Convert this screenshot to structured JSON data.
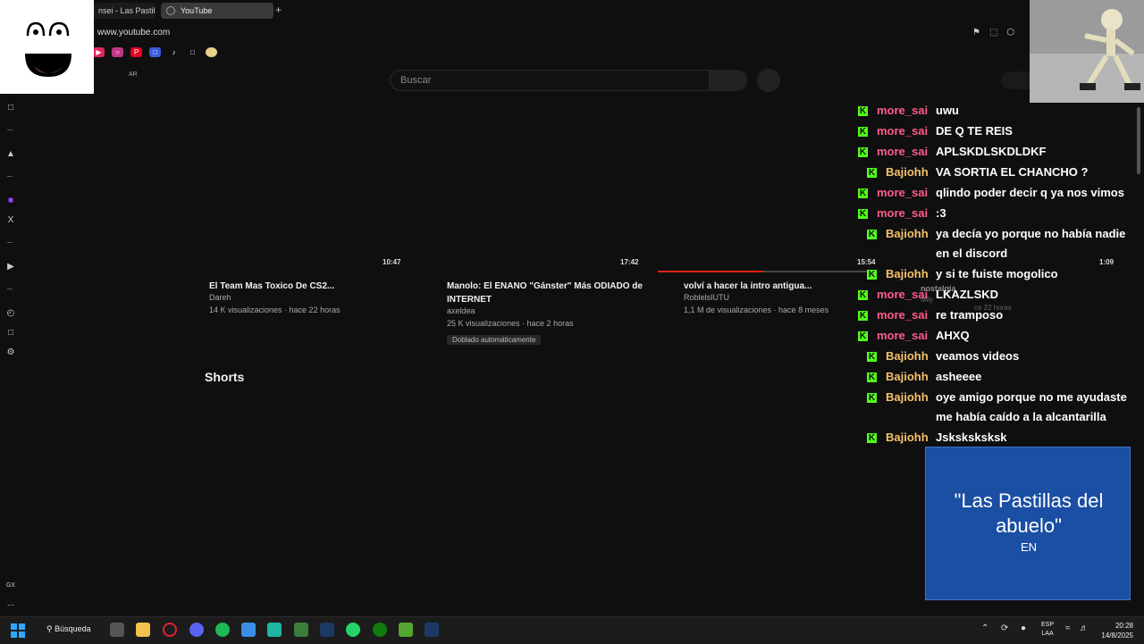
{
  "browser": {
    "tabs": [
      {
        "label": "nsei - Las Pastill"
      },
      {
        "label": "YouTube"
      }
    ],
    "new_tab": "+",
    "url": "www.youtube.com",
    "region": "AR",
    "search_placeholder": "Buscar"
  },
  "videos": [
    {
      "duration": "10:47",
      "title": "El Team Mas Toxico De CS2...",
      "channel": "Dareh",
      "meta": "14 K visualizaciones · hace 22 horas"
    },
    {
      "duration": "17:42",
      "title": "Manolo: El ENANO \"Gánster\" Más ODIADO de INTERNET",
      "channel": "axeldea",
      "meta": "25 K visualizaciones · hace 2 horas",
      "badge": "Doblado automáticamente"
    },
    {
      "duration": "15:54",
      "title": "volví a hacer la intro antigua...",
      "channel": "RoblelsIUTU",
      "meta": "1,1 M de visualizaciones · hace 8 meses",
      "progress": 0.5
    },
    {
      "duration": "1:09",
      "title": "nostalgia",
      "channel": "Mlly",
      "meta": "ce 22 horas"
    }
  ],
  "shorts_heading": "Shorts",
  "chat": [
    {
      "user": "more_sai",
      "text": "uwu",
      "color": "#ff5c8a"
    },
    {
      "user": "more_sai",
      "text": "DE Q TE REIS",
      "color": "#ff5c8a"
    },
    {
      "user": "more_sai",
      "text": "APLSKDLSKDLDKF",
      "color": "#ff5c8a"
    },
    {
      "user": "Bajiohh",
      "text": "VA SORTIA EL CHANCHO ?",
      "color": "#f5c26b"
    },
    {
      "user": "more_sai",
      "text": "qlindo poder decir q ya nos vimos",
      "color": "#ff5c8a"
    },
    {
      "user": "more_sai",
      "text": ":3",
      "color": "#ff5c8a"
    },
    {
      "user": "Bajiohh",
      "text": "ya decía yo porque no había nadie",
      "text2": "en el discord",
      "color": "#f5c26b"
    },
    {
      "user": "Bajiohh",
      "text": "y si te fuiste mogolico",
      "color": "#f5c26b"
    },
    {
      "user": "more_sai",
      "text": "LKAZLSKD",
      "color": "#ff5c8a"
    },
    {
      "user": "more_sai",
      "text": "re tramposo",
      "color": "#ff5c8a"
    },
    {
      "user": "more_sai",
      "text": "AHXQ",
      "color": "#ff5c8a"
    },
    {
      "user": "Bajiohh",
      "text": "veamos videos",
      "color": "#f5c26b"
    },
    {
      "user": "Bajiohh",
      "text": "asheeee",
      "color": "#f5c26b"
    },
    {
      "user": "Bajiohh",
      "text": "oye amigo porque no me ayudaste",
      "text2": "me había caído a la alcantarilla",
      "color": "#f5c26b"
    },
    {
      "user": "Bajiohh",
      "text": "Jsksksksksk",
      "color": "#f5c26b"
    }
  ],
  "info_box": {
    "title": "\"Las Pastillas del abuelo\"",
    "subtitle": "EN"
  },
  "taskbar": {
    "search": "Búsqueda",
    "lang1": "ESP",
    "lang2": "LAA",
    "time": "20:28",
    "date": "14/8/2025"
  },
  "sidebar_labels": {
    "gx": "GX",
    "more": "..."
  },
  "colors": {
    "accent_kick": "#53fc18",
    "youtube_red": "#e62117",
    "info_blue": "#1a4fa3"
  }
}
